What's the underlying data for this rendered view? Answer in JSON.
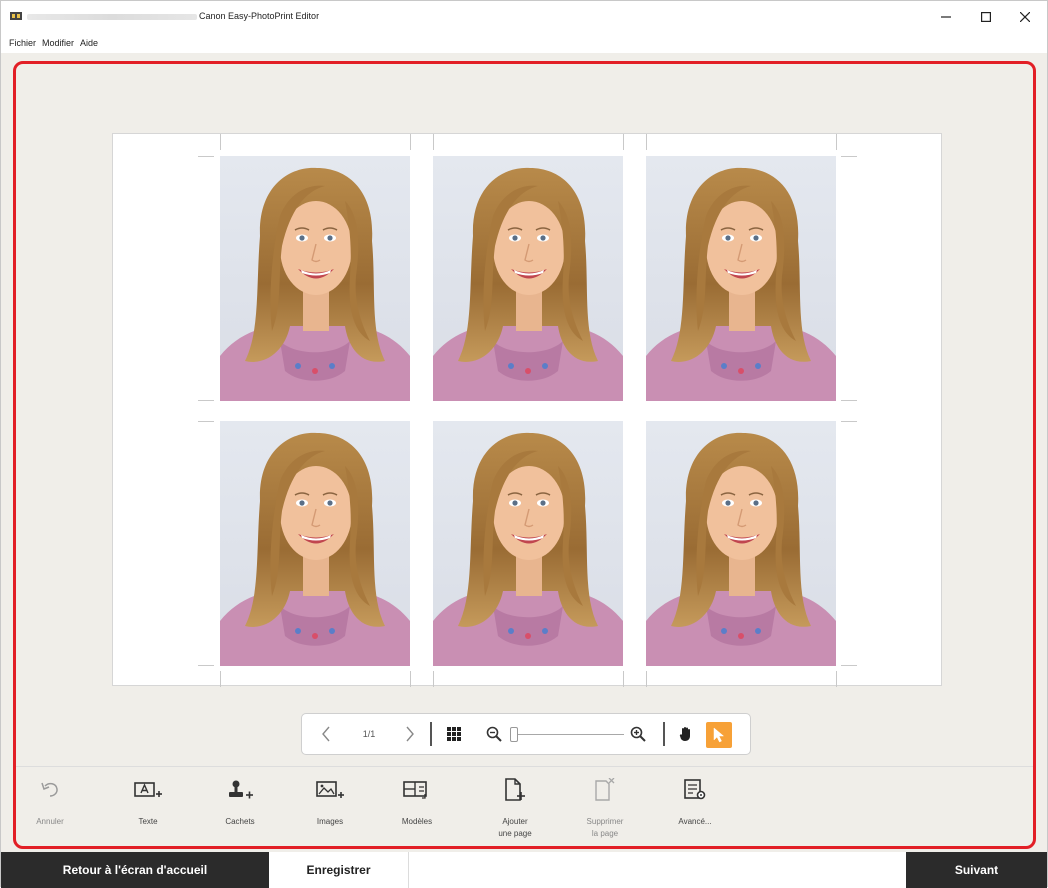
{
  "window": {
    "title": "Canon Easy-PhotoPrint Editor"
  },
  "menu": {
    "items": [
      "Fichier",
      "Modifier",
      "Aide"
    ]
  },
  "colors": {
    "highlight": "#e21f26",
    "accent": "#f7a137",
    "footer_dark": "#2b2b2b",
    "canvas_bg": "#f0eee9"
  },
  "nav": {
    "page_indicator": "1/1"
  },
  "tools": [
    {
      "label": "Annuler",
      "label2": "",
      "icon": "undo-icon",
      "enabled": false
    },
    {
      "label": "Texte",
      "label2": "",
      "icon": "add-text-icon",
      "enabled": true
    },
    {
      "label": "Cachets",
      "label2": "",
      "icon": "add-stamp-icon",
      "enabled": true
    },
    {
      "label": "Images",
      "label2": "",
      "icon": "add-image-icon",
      "enabled": true
    },
    {
      "label": "Modèles",
      "label2": "",
      "icon": "templates-icon",
      "enabled": true
    },
    {
      "label": "Ajouter",
      "label2": "une page",
      "icon": "add-page-icon",
      "enabled": true
    },
    {
      "label": "Supprimer",
      "label2": "la page",
      "icon": "delete-page-icon",
      "enabled": false
    },
    {
      "label": "Avancé...",
      "label2": "",
      "icon": "advanced-icon",
      "enabled": true
    }
  ],
  "footer": {
    "home_label": "Retour à l'écran d'accueil",
    "save_label": "Enregistrer",
    "next_label": "Suivant"
  }
}
